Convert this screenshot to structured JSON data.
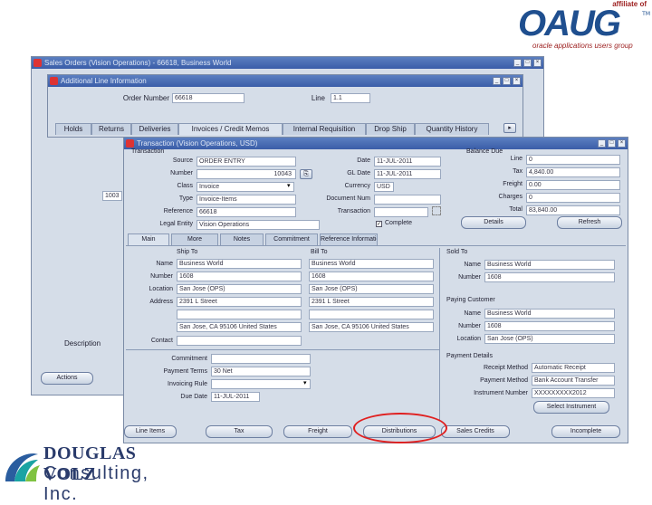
{
  "logos": {
    "oaug": {
      "affiliate": "affiliate of",
      "word": "OAUG",
      "tm": "TM",
      "sub": "oracle applications users group"
    },
    "dvc": {
      "line1": "DOUGLAS VOLZ",
      "line2": "Consulting, Inc."
    }
  },
  "sales_window": {
    "title": "Sales Orders (Vision Operations) - 66618, Business World",
    "row_value": "1003",
    "description_label": "Description",
    "actions_label": "Actions"
  },
  "line_info": {
    "title": "Additional Line Information",
    "order_number_label": "Order Number",
    "order_number": "66618",
    "line_label": "Line",
    "line": "1.1",
    "tabs": [
      "Holds",
      "Returns",
      "Deliveries",
      "Invoices / Credit Memos",
      "Internal Requisition",
      "Drop Ship",
      "Quantity History"
    ]
  },
  "transaction": {
    "title": "Transaction (Vision Operations, USD)",
    "section_transaction": "Transaction",
    "section_balance": "Balance Due",
    "labels": {
      "source": "Source",
      "number": "Number",
      "class": "Class",
      "type": "Type",
      "reference": "Reference",
      "legal_entity": "Legal Entity",
      "date": "Date",
      "gl_date": "GL Date",
      "currency": "Currency",
      "document_num": "Document Num",
      "transaction": "Transaction",
      "complete": "Complete"
    },
    "values": {
      "source": "ORDER ENTRY",
      "number": "10043",
      "class": "Invoice",
      "type": "Invoice-Items",
      "reference": "66618",
      "legal_entity": "Vision Operations",
      "date": "11-JUL-2011",
      "gl_date": "11-JUL-2011",
      "currency": "USD",
      "document_num": "",
      "transaction": ""
    },
    "balance_labels": {
      "line": "Line",
      "tax": "Tax",
      "freight": "Freight",
      "charges": "Charges",
      "total": "Total"
    },
    "balance_values": {
      "line": "0",
      "tax": "4,840.00",
      "freight": "0.00",
      "charges": "0",
      "total": "83,840.00"
    },
    "details_button": "Details",
    "refresh_button": "Refresh",
    "subtabs": [
      "Main",
      "More",
      "Notes",
      "Commitment",
      "Reference Information"
    ],
    "ship_to": {
      "heading": "Ship To",
      "labels": {
        "name": "Name",
        "number": "Number",
        "location": "Location",
        "address": "Address",
        "contact": "Contact"
      },
      "name": "Business World",
      "number": "1608",
      "location": "San Jose (OPS)",
      "address": "2391 L Street",
      "city": "San Jose, CA 95106 United States"
    },
    "bill_to": {
      "heading": "Bill To",
      "name": "Business World",
      "number": "1608",
      "location": "San Jose (OPS)",
      "address": "2391 L Street",
      "city": "San Jose, CA 95106 United States"
    },
    "sold_to": {
      "heading": "Sold To",
      "name_label": "Name",
      "number_label": "Number",
      "name": "Business World",
      "number": "1608"
    },
    "paying_customer": {
      "heading": "Paying Customer",
      "name_label": "Name",
      "number_label": "Number",
      "location_label": "Location",
      "name": "Business World",
      "number": "1608",
      "location": "San Jose (OPS)"
    },
    "commitment": {
      "label": "Commitment",
      "payment_terms_label": "Payment Terms",
      "payment_terms": "30 Net",
      "invoicing_rule_label": "Invoicing Rule",
      "due_date_label": "Due Date",
      "due_date": "11-JUL-2011"
    },
    "payment_details": {
      "heading": "Payment Details",
      "receipt_method_label": "Receipt Method",
      "receipt_method": "Automatic Receipt",
      "payment_method_label": "Payment Method",
      "payment_method": "Bank Account Transfer",
      "instrument_number_label": "Instrument Number",
      "instrument_number": "XXXXXXXXX2012",
      "select_button": "Select Instrument"
    },
    "bottom_buttons": [
      "Line Items",
      "Tax",
      "Freight",
      "Distributions",
      "Sales Credits",
      "Incomplete"
    ]
  }
}
